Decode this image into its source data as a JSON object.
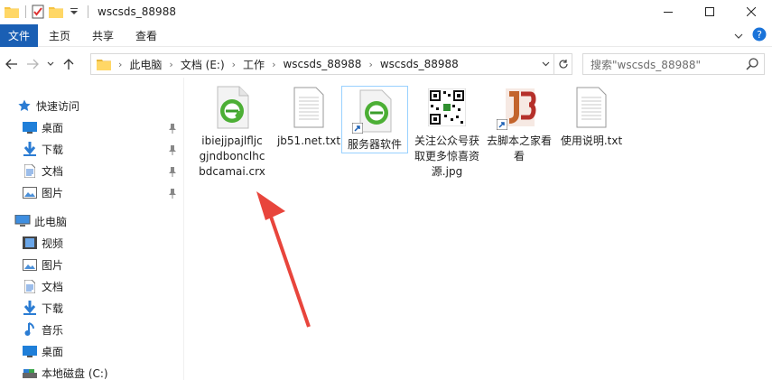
{
  "window": {
    "title": "wscsds_88988",
    "controls": [
      "minimize",
      "maximize",
      "close"
    ]
  },
  "ribbon": {
    "tabs": [
      "文件",
      "主页",
      "共享",
      "查看"
    ],
    "active_tab": "文件",
    "accent": "#1a5fb4"
  },
  "address": {
    "crumbs": [
      "此电脑",
      "文档 (E:)",
      "工作",
      "wscsds_88988",
      "wscsds_88988"
    ]
  },
  "search": {
    "placeholder": "搜索\"wscsds_88988\""
  },
  "sidebar": {
    "quick_access": "快速访问",
    "quick_items": [
      "桌面",
      "下载",
      "文档",
      "图片"
    ],
    "this_pc": "此电脑",
    "pc_items": [
      "视频",
      "图片",
      "文档",
      "下载",
      "音乐",
      "桌面",
      "本地磁盘 (C:)"
    ]
  },
  "files": [
    {
      "name": "ibiejjpajlfljcgjndbonclhcbdcamai.crx",
      "icon": "crx-file-icon"
    },
    {
      "name": "jb51.net.txt",
      "icon": "text-file-icon"
    },
    {
      "name": "服务器软件",
      "icon": "shortcut-app-icon"
    },
    {
      "name": "关注公众号获取更多惊喜资源.jpg",
      "icon": "qr-image-icon"
    },
    {
      "name": "去脚本之家看看",
      "icon": "jb51-shortcut-icon"
    },
    {
      "name": "使用说明.txt",
      "icon": "text-file-icon"
    }
  ],
  "annotation": {
    "color": "#e8453c",
    "icon": "red-arrow-icon"
  }
}
